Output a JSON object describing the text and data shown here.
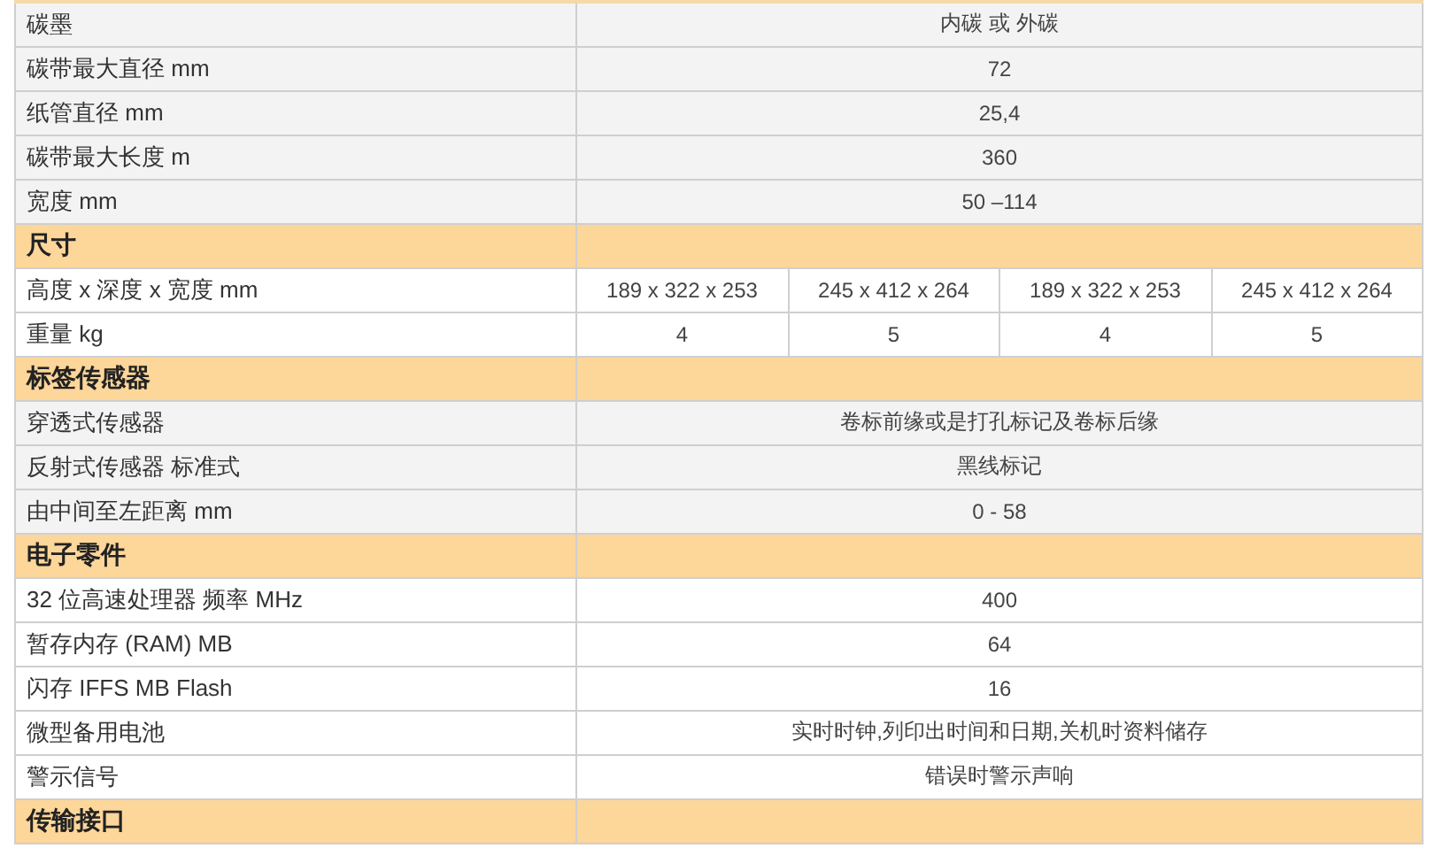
{
  "groups": [
    {
      "rows": [
        {
          "label": "碳墨",
          "values": [
            "内碳 或 外碳"
          ]
        },
        {
          "label": "碳带最大直径 mm",
          "values": [
            "72"
          ]
        },
        {
          "label": "纸管直径 mm",
          "values": [
            "25,4"
          ]
        },
        {
          "label": "碳带最大长度 m",
          "values": [
            "360"
          ]
        },
        {
          "label": "宽度 mm",
          "values": [
            "50 –114"
          ]
        }
      ]
    },
    {
      "title": "尺寸",
      "rows": [
        {
          "label": "高度 x 深度 x 宽度 mm",
          "values": [
            "189 x 322 x 253",
            "245 x 412 x 264",
            "189 x 322 x 253",
            "245 x 412 x 264"
          ]
        },
        {
          "label": "重量 kg",
          "values": [
            "4",
            "5",
            "4",
            "5"
          ]
        }
      ]
    },
    {
      "title": "标签传感器",
      "rows": [
        {
          "label": "穿透式传感器",
          "values": [
            "卷标前缘或是打孔标记及卷标后缘"
          ]
        },
        {
          "label": "反射式传感器 标准式",
          "values": [
            "黑线标记"
          ]
        },
        {
          "label": "由中间至左距离 mm",
          "values": [
            "0 - 58"
          ]
        }
      ]
    },
    {
      "title": "电子零件",
      "rows": [
        {
          "label": "32 位高速处理器 频率 MHz",
          "values": [
            "400"
          ]
        },
        {
          "label": "暂存内存 (RAM) MB",
          "values": [
            "64"
          ]
        },
        {
          "label": "闪存 IFFS MB Flash",
          "values": [
            "16"
          ]
        },
        {
          "label": "微型备用电池",
          "values": [
            "实时时钟,列印出时间和日期,关机时资料储存"
          ]
        },
        {
          "label": "警示信号",
          "values": [
            "错误时警示声响"
          ]
        }
      ]
    },
    {
      "title": "传输接口"
    }
  ]
}
